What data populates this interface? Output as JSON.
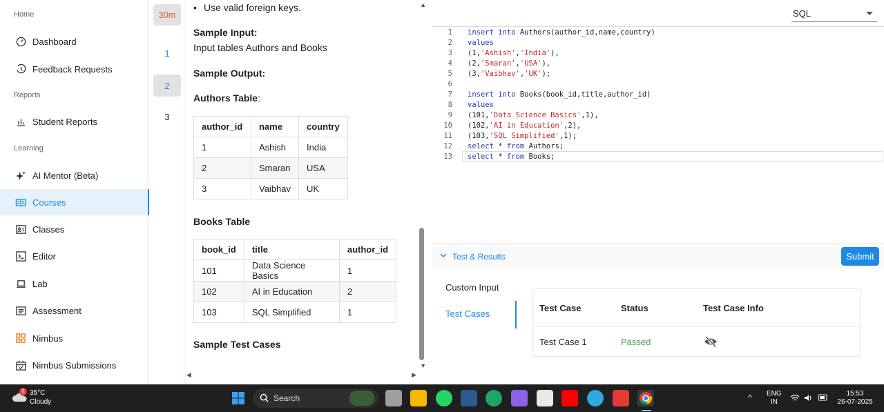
{
  "sidebar": {
    "sections": [
      "Home",
      "Reports",
      "Learning"
    ],
    "items": [
      {
        "label": "Dashboard",
        "icon": "dashboard-icon"
      },
      {
        "label": "Feedback Requests",
        "icon": "feedback-icon"
      },
      {
        "label": "Student Reports",
        "icon": "bar-chart-icon"
      },
      {
        "label": "AI Mentor (Beta)",
        "icon": "sparkle-icon"
      },
      {
        "label": "Courses",
        "icon": "book-icon",
        "active": true
      },
      {
        "label": "Classes",
        "icon": "classes-icon"
      },
      {
        "label": "Editor",
        "icon": "terminal-icon"
      },
      {
        "label": "Lab",
        "icon": "laptop-icon"
      },
      {
        "label": "Assessment",
        "icon": "list-icon"
      },
      {
        "label": "Nimbus",
        "icon": "grid-icon"
      },
      {
        "label": "Nimbus Submissions",
        "icon": "calendar-icon"
      }
    ]
  },
  "rail": {
    "timer": "30m",
    "questions": [
      "1",
      "2",
      "3"
    ],
    "selected": "2"
  },
  "problem": {
    "bullet": "Use valid foreign keys.",
    "sample_input_heading": "Sample Input:",
    "sample_input_text": "Input tables Authors and Books",
    "sample_output_heading": "Sample Output:",
    "authors_heading": "Authors Table",
    "authors_colon": ":",
    "authors_table": {
      "headers": [
        "author_id",
        "name",
        "country"
      ],
      "rows": [
        [
          "1",
          "Ashish",
          "India"
        ],
        [
          "2",
          "Smaran",
          "USA"
        ],
        [
          "3",
          "Vaibhav",
          "UK"
        ]
      ]
    },
    "books_heading": "Books Table",
    "books_table": {
      "headers": [
        "book_id",
        "title",
        "author_id"
      ],
      "rows": [
        [
          "101",
          "Data Science Basics",
          "1"
        ],
        [
          "102",
          "AI in Education",
          "2"
        ],
        [
          "103",
          "SQL Simplified",
          "1"
        ]
      ]
    },
    "sample_test_cases_heading": "Sample Test Cases"
  },
  "editor": {
    "language": "SQL",
    "lines": [
      {
        "n": "1",
        "tokens": [
          [
            "kw",
            "insert into "
          ],
          [
            "",
            "Authors(author_id,name,country)"
          ]
        ]
      },
      {
        "n": "2",
        "tokens": [
          [
            "kw",
            "values"
          ]
        ]
      },
      {
        "n": "3",
        "tokens": [
          [
            "",
            "(1,"
          ],
          [
            "str",
            "'Ashish'"
          ],
          [
            "",
            ","
          ],
          [
            "str",
            "'India'"
          ],
          [
            "",
            "),"
          ]
        ]
      },
      {
        "n": "4",
        "tokens": [
          [
            "",
            "(2,"
          ],
          [
            "str",
            "'Smaran'"
          ],
          [
            "",
            ","
          ],
          [
            "str",
            "'USA'"
          ],
          [
            "",
            "),"
          ]
        ]
      },
      {
        "n": "5",
        "tokens": [
          [
            "",
            "(3,"
          ],
          [
            "str",
            "'Vaibhav'"
          ],
          [
            "",
            ","
          ],
          [
            "str",
            "'UK'"
          ],
          [
            "",
            ");"
          ]
        ]
      },
      {
        "n": "6",
        "tokens": []
      },
      {
        "n": "7",
        "tokens": [
          [
            "kw",
            "insert into "
          ],
          [
            "",
            "Books(book_id,title,author_id)"
          ]
        ]
      },
      {
        "n": "8",
        "tokens": [
          [
            "kw",
            "values"
          ]
        ]
      },
      {
        "n": "9",
        "tokens": [
          [
            "",
            "(101,"
          ],
          [
            "str",
            "'Data Science Basics'"
          ],
          [
            "",
            ",1),"
          ]
        ]
      },
      {
        "n": "10",
        "tokens": [
          [
            "",
            "(102,"
          ],
          [
            "str",
            "'AI in Education'"
          ],
          [
            "",
            ",2),"
          ]
        ]
      },
      {
        "n": "11",
        "tokens": [
          [
            "",
            "(103,"
          ],
          [
            "str",
            "'SQL Simplified'"
          ],
          [
            "",
            ",1);"
          ]
        ]
      },
      {
        "n": "12",
        "tokens": [
          [
            "kw",
            "select "
          ],
          [
            "",
            "* "
          ],
          [
            "kw",
            "from "
          ],
          [
            "",
            "Authors;"
          ]
        ]
      },
      {
        "n": "13",
        "tokens": [
          [
            "kw",
            "select "
          ],
          [
            "",
            "* "
          ],
          [
            "kw",
            "from "
          ],
          [
            "",
            "Books;"
          ]
        ]
      }
    ]
  },
  "results": {
    "section_label": "Test & Results",
    "submit_label": "Submit",
    "tabs": [
      "Custom Input",
      "Test Cases"
    ],
    "active_tab": "Test Cases",
    "table_headers": [
      "Test Case",
      "Status",
      "Test Case Info"
    ],
    "rows": [
      {
        "name": "Test Case 1",
        "status": "Passed",
        "status_color": "#43a047",
        "info_icon": "eye-off-icon"
      }
    ]
  },
  "taskbar": {
    "weather_badge": "5",
    "temperature": "35°C",
    "condition": "Cloudy",
    "search_label": "Search",
    "lang_top": "ENG",
    "lang_bottom": "IN",
    "time": "15:53",
    "date": "26-07-2025"
  },
  "colors": {
    "accent": "#1e88e5",
    "timer": "#e05a3a",
    "passed": "#43a047"
  }
}
